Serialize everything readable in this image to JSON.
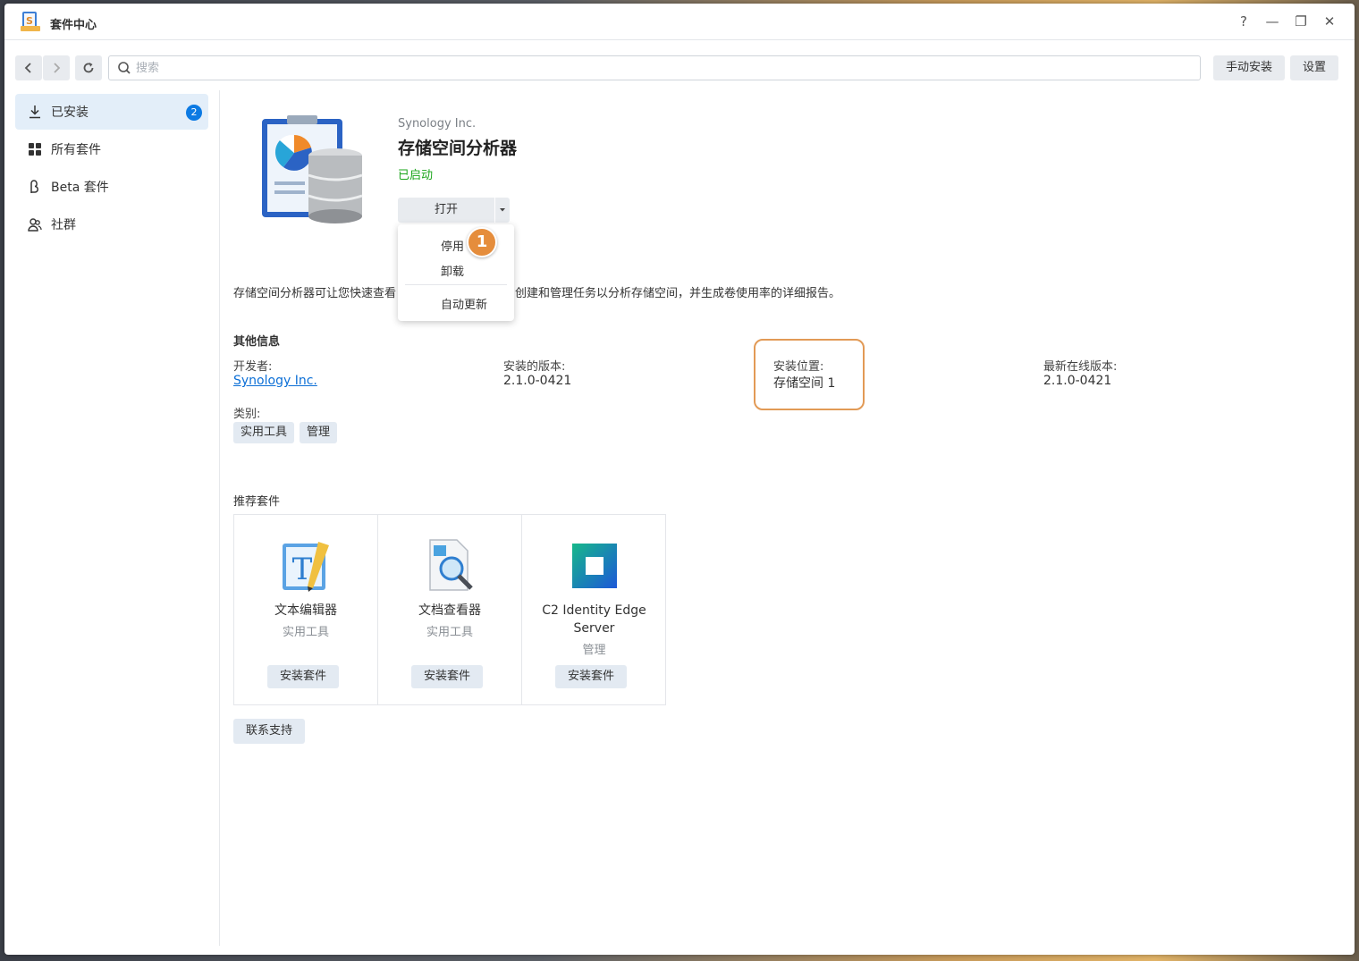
{
  "window": {
    "title": "套件中心"
  },
  "controls": {
    "help": "?",
    "minimize": "—",
    "maximize": "❐",
    "close": "✕"
  },
  "toolbar": {
    "search_placeholder": "搜索",
    "manual_install": "手动安装",
    "settings": "设置"
  },
  "sidebar": {
    "items": [
      {
        "label": "已安装",
        "badge": "2",
        "icon": "download-icon"
      },
      {
        "label": "所有套件",
        "icon": "grid-icon"
      },
      {
        "label": "Beta 套件",
        "icon": "beta-icon"
      },
      {
        "label": "社群",
        "icon": "community-icon"
      }
    ]
  },
  "package": {
    "vendor": "Synology Inc.",
    "name": "存储空间分析器",
    "status": "已启动",
    "open_label": "打开",
    "description_start": "存储空间分析器可让您快速查看",
    "description_end": "体使用率趋势、创建和管理任务以分析存储空间，并生成卷使用率的详细报告。"
  },
  "menu": {
    "items": [
      "停用",
      "卸载",
      "自动更新"
    ],
    "step_marker": "1"
  },
  "info": {
    "title": "其他信息",
    "developer_label": "开发者:",
    "developer_value": "Synology Inc.",
    "version_label": "安装的版本:",
    "version_value": "2.1.0-0421",
    "location_label": "安装位置:",
    "location_value": "存储空间 1",
    "latest_label": "最新在线版本:",
    "latest_value": "2.1.0-0421",
    "category_label": "类别:",
    "tags": [
      "实用工具",
      "管理"
    ]
  },
  "recommended": {
    "title": "推荐套件",
    "cards": [
      {
        "name": "文本编辑器",
        "category": "实用工具",
        "button": "安装套件"
      },
      {
        "name": "文档查看器",
        "category": "实用工具",
        "button": "安装套件"
      },
      {
        "name": "C2 Identity Edge Server",
        "category": "管理",
        "button": "安装套件"
      }
    ]
  },
  "support_label": "联系支持",
  "colors": {
    "accent": "#0c7ae3",
    "status_green": "#1aa51a",
    "highlight": "#e29a56",
    "marker": "#e58d3c"
  }
}
